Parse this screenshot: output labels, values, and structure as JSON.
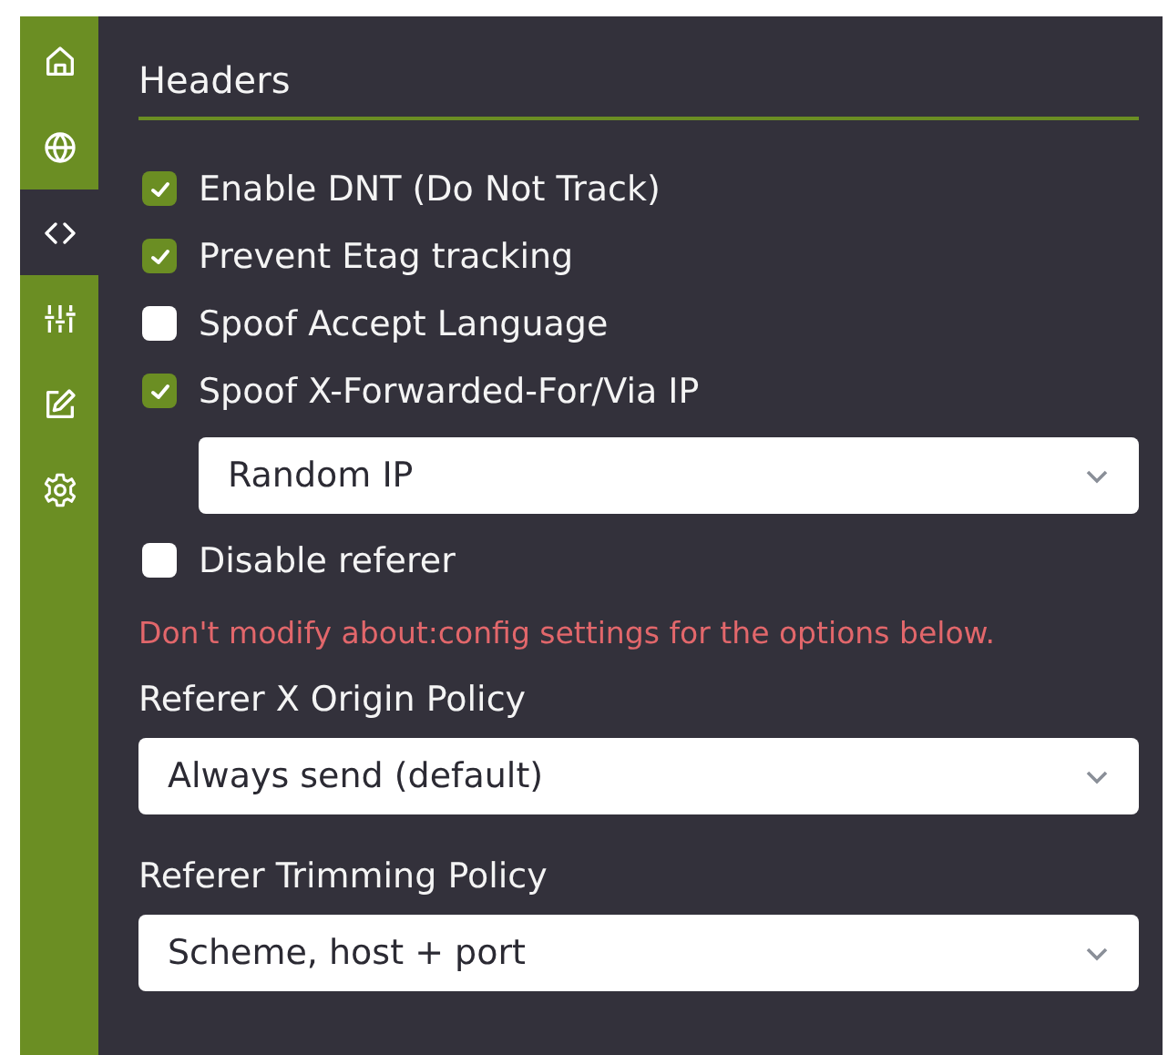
{
  "sidebar": {
    "items": [
      {
        "selected": false
      },
      {
        "selected": false
      },
      {
        "selected": true
      },
      {
        "selected": false
      },
      {
        "selected": false
      },
      {
        "selected": false
      }
    ]
  },
  "section": {
    "title": "Headers",
    "items": [
      {
        "kind": "checkbox",
        "label": "Enable DNT (Do Not Track)",
        "checked": true
      },
      {
        "kind": "checkbox",
        "label": "Prevent Etag tracking",
        "checked": true
      },
      {
        "kind": "checkbox",
        "label": "Spoof Accept Language",
        "checked": false
      },
      {
        "kind": "checkbox",
        "label": "Spoof X-Forwarded-For/Via IP",
        "checked": true,
        "children": [
          {
            "kind": "select",
            "value": "Random IP"
          }
        ]
      },
      {
        "kind": "checkbox",
        "label": "Disable referer",
        "checked": false
      },
      {
        "kind": "note",
        "text": "Don't modify about:config settings for the options below."
      },
      {
        "kind": "select",
        "label": "Referer X Origin Policy",
        "value": "Always send (default)"
      },
      {
        "kind": "select",
        "label": "Referer Trimming Policy",
        "value": "Scheme, host + port"
      }
    ]
  }
}
